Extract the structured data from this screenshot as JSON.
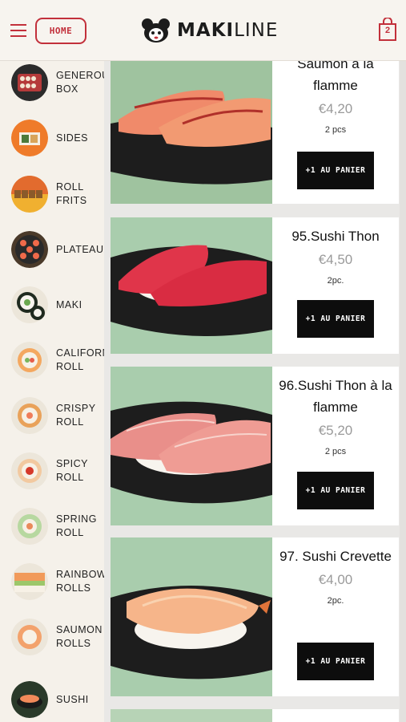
{
  "header": {
    "home_label": "HOME",
    "logo_bold": "MAKI",
    "logo_light": "LINE",
    "cart_count": "2",
    "accent_color": "#c2303b"
  },
  "sidebar": {
    "items": [
      {
        "label": "GENEROUS\nBOX"
      },
      {
        "label": "SIDES"
      },
      {
        "label": "ROLL\nFRITS"
      },
      {
        "label": "PLATEAUX"
      },
      {
        "label": "MAKI"
      },
      {
        "label": "CALIFORNIA\nROLL"
      },
      {
        "label": "CRISPY\nROLL"
      },
      {
        "label": "SPICY\nROLL"
      },
      {
        "label": "SPRING\nROLL"
      },
      {
        "label": "RAINBOW\nROLLS"
      },
      {
        "label": "SAUMON\nROLLS"
      },
      {
        "label": "SUSHI"
      }
    ]
  },
  "products": [
    {
      "name": "Saumon à la flamme",
      "price": "€4,20",
      "qty": "2 pcs",
      "button": "+1 AU PANIER",
      "fish_color": "#f08a6a"
    },
    {
      "name": "95.Sushi Thon",
      "price": "€4,50",
      "qty": "2pc.",
      "button": "+1 AU PANIER",
      "fish_color": "#e0354a"
    },
    {
      "name": "96.Sushi Thon à la flamme",
      "price": "€5,20",
      "qty": "2 pcs",
      "button": "+1 AU PANIER",
      "fish_color": "#e98f8a"
    },
    {
      "name": "97. Sushi Crevette",
      "price": "€4,00",
      "qty": "2pc.",
      "button": "+1 AU PANIER",
      "fish_color": "#f6b58a"
    }
  ]
}
